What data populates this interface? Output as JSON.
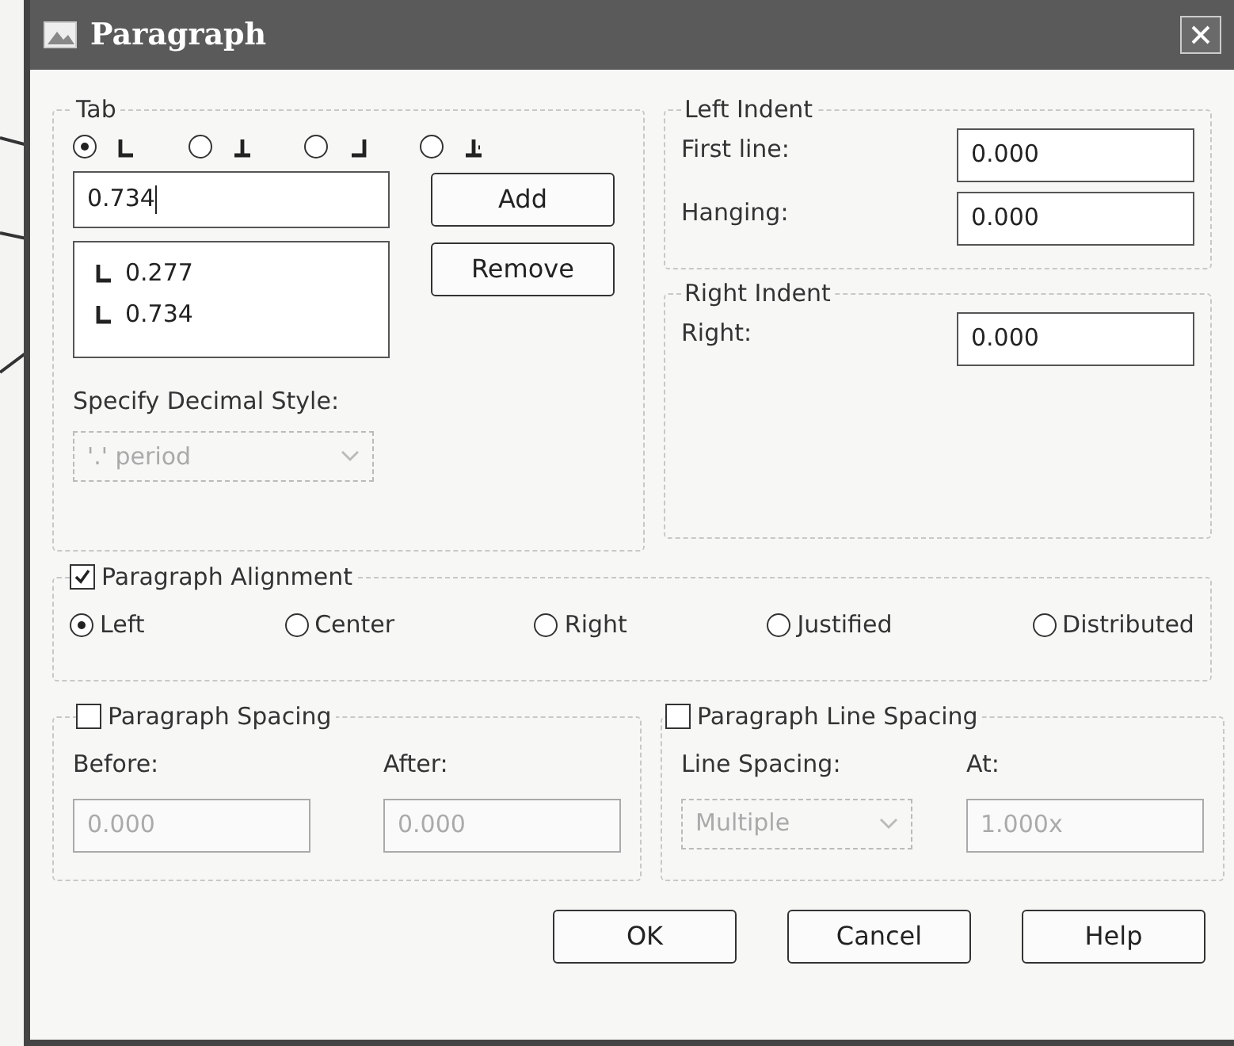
{
  "window": {
    "title": "Paragraph"
  },
  "tab": {
    "label": "Tab",
    "alignments": [
      {
        "kind": "left",
        "selected": true
      },
      {
        "kind": "center",
        "selected": false
      },
      {
        "kind": "right",
        "selected": false
      },
      {
        "kind": "decimal",
        "selected": false
      }
    ],
    "position": {
      "value": "0.734"
    },
    "add_button": "Add",
    "remove_button": "Remove",
    "stops": [
      {
        "kind": "left",
        "text": "0.277"
      },
      {
        "kind": "left",
        "text": "0.734"
      }
    ],
    "decimal_style": {
      "label": "Specify Decimal Style:",
      "value": "'.' period",
      "disabled": true
    }
  },
  "left_indent": {
    "title": "Left Indent",
    "fields": [
      {
        "label": "First line:",
        "value": "0.000"
      },
      {
        "label": "Hanging:",
        "value": "0.000"
      }
    ]
  },
  "right_indent": {
    "title": "Right Indent",
    "fields": [
      {
        "label": "Right:",
        "value": "0.000"
      }
    ]
  },
  "alignment": {
    "label": "Paragraph Alignment",
    "checked": true,
    "options": [
      {
        "label": "Left",
        "selected": true
      },
      {
        "label": "Center",
        "selected": false
      },
      {
        "label": "Right",
        "selected": false
      },
      {
        "label": "Justified",
        "selected": false
      },
      {
        "label": "Distributed",
        "selected": false
      }
    ]
  },
  "spacing": {
    "label": "Paragraph Spacing",
    "checked": false,
    "fields": [
      {
        "label": "Before:",
        "value": "0.000",
        "disabled": true
      },
      {
        "label": "After:",
        "value": "0.000",
        "disabled": true
      }
    ]
  },
  "line_spacing": {
    "label": "Paragraph Line Spacing",
    "checked": false,
    "mode": {
      "label": "Line Spacing:",
      "value": "Multiple",
      "disabled": true
    },
    "at": {
      "label": "At:",
      "value": "1.000x",
      "disabled": true
    }
  },
  "buttons": [
    "OK",
    "Cancel",
    "Help"
  ]
}
